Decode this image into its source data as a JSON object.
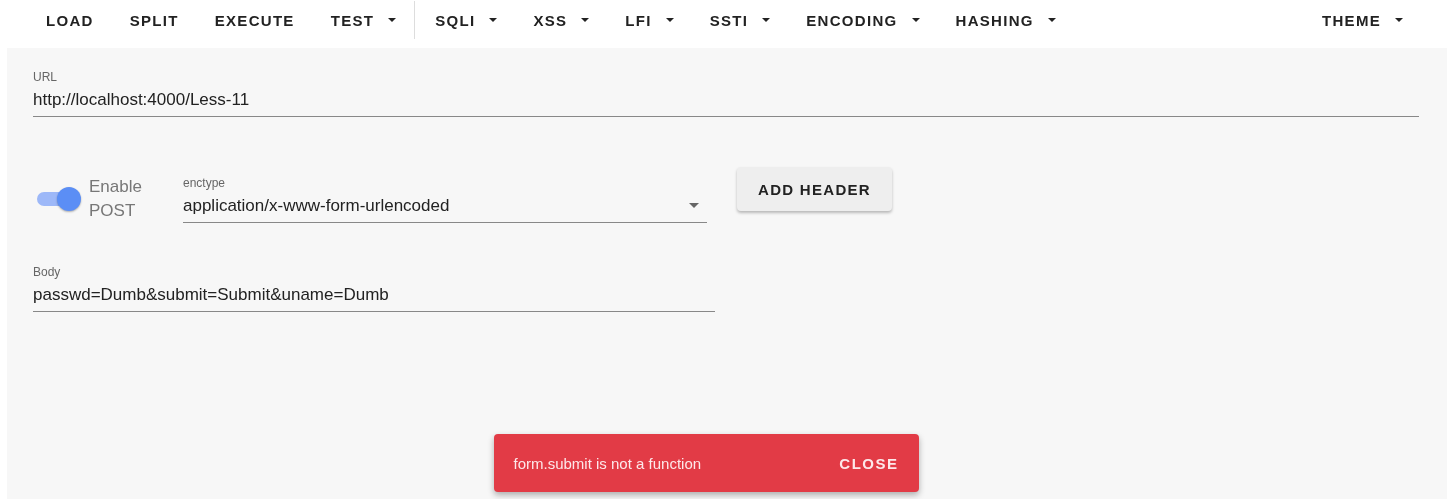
{
  "toolbar": [
    {
      "label": "LOAD",
      "has_menu": false,
      "separator_after": false
    },
    {
      "label": "SPLIT",
      "has_menu": false,
      "separator_after": false
    },
    {
      "label": "EXECUTE",
      "has_menu": false,
      "separator_after": false
    },
    {
      "label": "TEST",
      "has_menu": true,
      "separator_after": true
    },
    {
      "label": "SQLI",
      "has_menu": true,
      "separator_after": false
    },
    {
      "label": "XSS",
      "has_menu": true,
      "separator_after": false
    },
    {
      "label": "LFI",
      "has_menu": true,
      "separator_after": false
    },
    {
      "label": "SSTI",
      "has_menu": true,
      "separator_after": false
    },
    {
      "label": "ENCODING",
      "has_menu": true,
      "separator_after": false
    },
    {
      "label": "HASHING",
      "has_menu": true,
      "separator_after": false
    }
  ],
  "theme_menu": {
    "label": "THEME",
    "has_menu": true
  },
  "url_field": {
    "label": "URL",
    "value": "http://localhost:4000/Less-11"
  },
  "post_toggle": {
    "label": "Enable POST",
    "on": true
  },
  "enctype_select": {
    "label": "enctype",
    "value": "application/x-www-form-urlencoded"
  },
  "add_header_button": "ADD HEADER",
  "body_field": {
    "label": "Body",
    "value": "passwd=Dumb&submit=Submit&uname=Dumb"
  },
  "snackbar": {
    "message": "form.submit is not a function",
    "action": "CLOSE"
  }
}
